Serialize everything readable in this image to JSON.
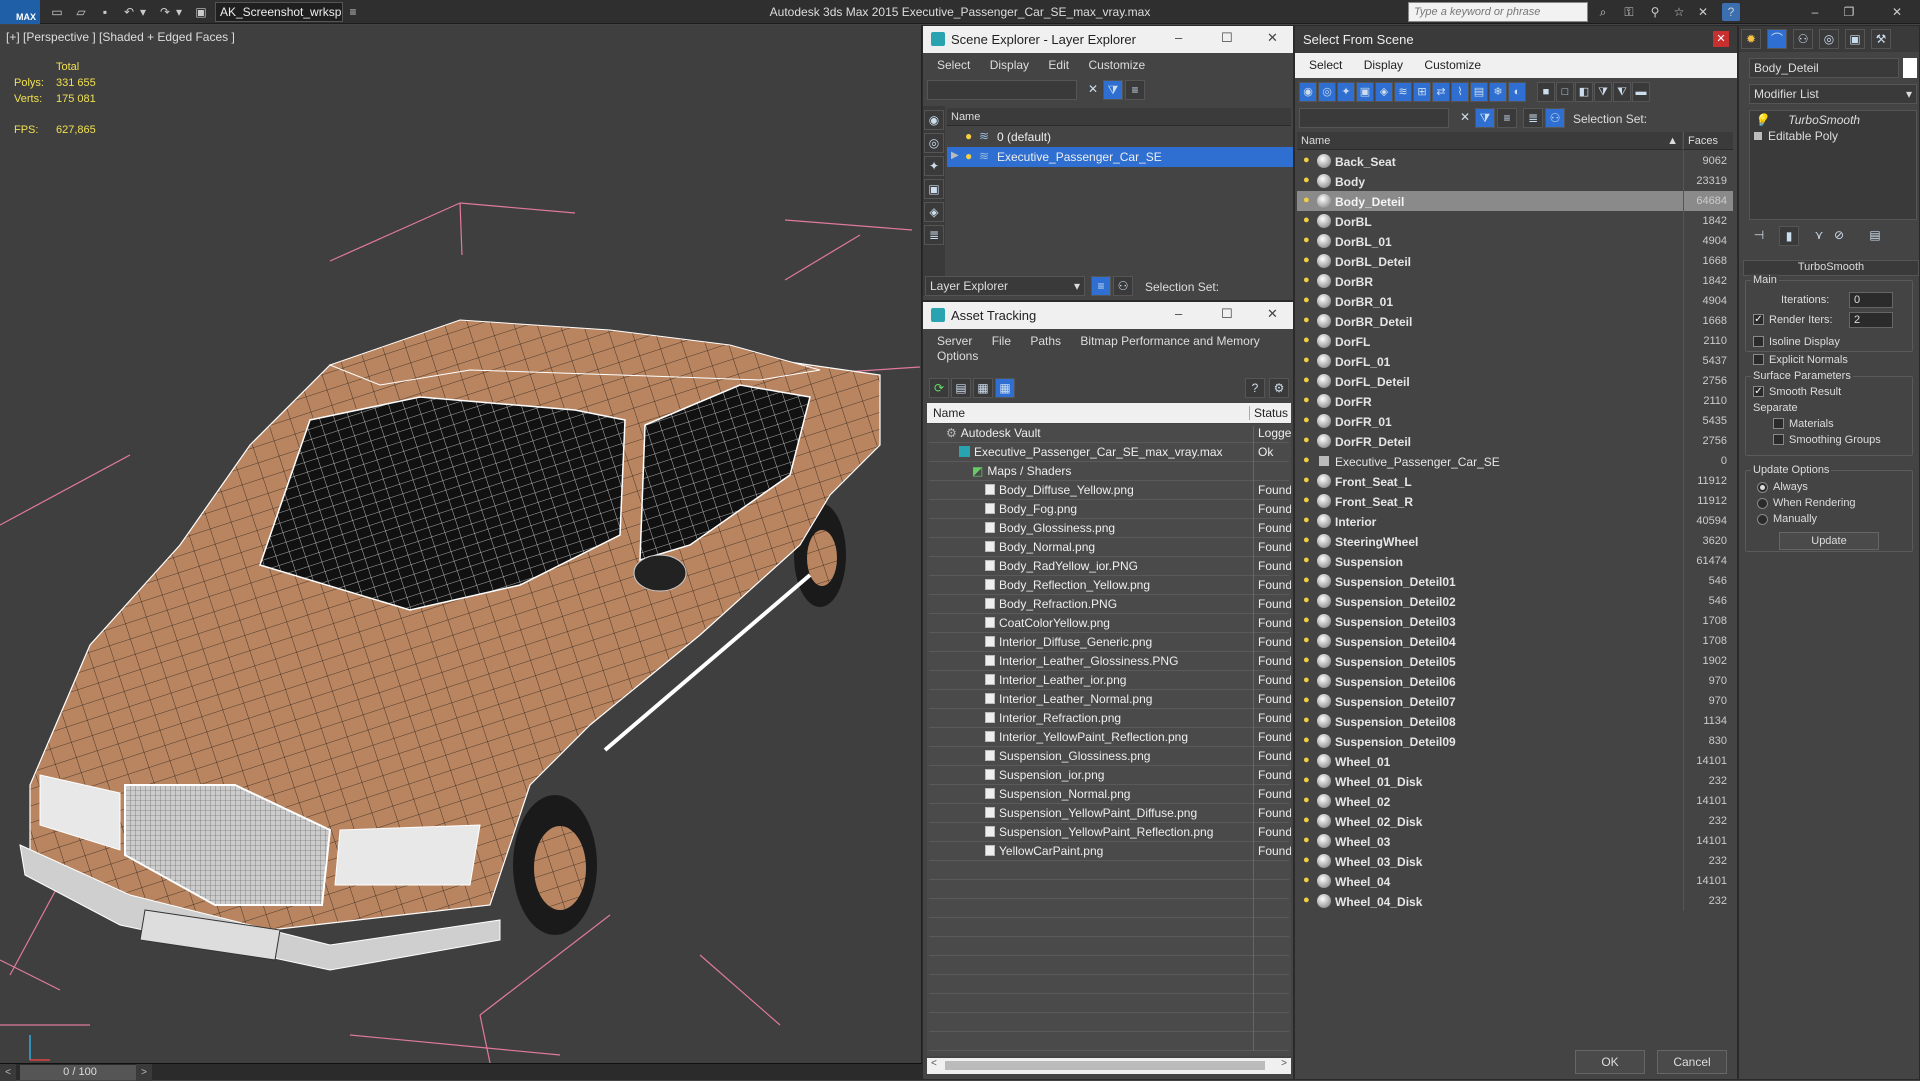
{
  "app": {
    "logo": "MAX",
    "title": "Autodesk 3ds Max  2015     Executive_Passenger_Car_SE_max_vray.max",
    "workspace": "AK_Screenshot_wrksp",
    "search_placeholder": "Type a keyword or phrase"
  },
  "viewport": {
    "label": "[+] [Perspective ] [Shaded + Edged Faces ]",
    "stats": {
      "total_label": "Total",
      "polys_label": "Polys:",
      "polys": "331 655",
      "verts_label": "Verts:",
      "verts": "175 081",
      "fps_label": "FPS:",
      "fps": "627,865"
    },
    "timeline": "0 / 100"
  },
  "scene_explorer": {
    "title": "Scene Explorer - Layer Explorer",
    "menu": [
      "Select",
      "Display",
      "Edit",
      "Customize"
    ],
    "col_name": "Name",
    "layers": [
      {
        "name": "0 (default)",
        "selected": false
      },
      {
        "name": "Executive_Passenger_Car_SE",
        "selected": true
      }
    ],
    "footer_dropdown": "Layer Explorer",
    "selection_set_label": "Selection Set:"
  },
  "asset_tracking": {
    "title": "Asset Tracking",
    "menu": [
      "Server",
      "File",
      "Paths",
      "Bitmap Performance and Memory"
    ],
    "menu2": "Options",
    "col_name": "Name",
    "col_status": "Status",
    "rows": [
      {
        "name": "Autodesk Vault",
        "status": "Logged",
        "indent": 1
      },
      {
        "name": "Executive_Passenger_Car_SE_max_vray.max",
        "status": "Ok",
        "indent": 2
      },
      {
        "name": "Maps / Shaders",
        "status": "",
        "indent": 3
      },
      {
        "name": "Body_Diffuse_Yellow.png",
        "status": "Found",
        "indent": 4
      },
      {
        "name": "Body_Fog.png",
        "status": "Found",
        "indent": 4
      },
      {
        "name": "Body_Glossiness.png",
        "status": "Found",
        "indent": 4
      },
      {
        "name": "Body_Normal.png",
        "status": "Found",
        "indent": 4
      },
      {
        "name": "Body_RadYellow_ior.PNG",
        "status": "Found",
        "indent": 4
      },
      {
        "name": "Body_Reflection_Yellow.png",
        "status": "Found",
        "indent": 4
      },
      {
        "name": "Body_Refraction.PNG",
        "status": "Found",
        "indent": 4
      },
      {
        "name": "CoatColorYellow.png",
        "status": "Found",
        "indent": 4
      },
      {
        "name": "Interior_Diffuse_Generic.png",
        "status": "Found",
        "indent": 4
      },
      {
        "name": "Interior_Leather_Glossiness.PNG",
        "status": "Found",
        "indent": 4
      },
      {
        "name": "Interior_Leather_ior.png",
        "status": "Found",
        "indent": 4
      },
      {
        "name": "Interior_Leather_Normal.png",
        "status": "Found",
        "indent": 4
      },
      {
        "name": "Interior_Refraction.png",
        "status": "Found",
        "indent": 4
      },
      {
        "name": "Interior_YellowPaint_Reflection.png",
        "status": "Found",
        "indent": 4
      },
      {
        "name": "Suspension_Glossiness.png",
        "status": "Found",
        "indent": 4
      },
      {
        "name": "Suspension_ior.png",
        "status": "Found",
        "indent": 4
      },
      {
        "name": "Suspension_Normal.png",
        "status": "Found",
        "indent": 4
      },
      {
        "name": "Suspension_YellowPaint_Diffuse.png",
        "status": "Found",
        "indent": 4
      },
      {
        "name": "Suspension_YellowPaint_Reflection.png",
        "status": "Found",
        "indent": 4
      },
      {
        "name": "YellowCarPaint.png",
        "status": "Found",
        "indent": 4
      }
    ]
  },
  "select_from_scene": {
    "title": "Select From Scene",
    "menu": [
      "Select",
      "Display",
      "Customize"
    ],
    "selection_set_label": "Selection Set:",
    "col_name": "Name",
    "col_faces": "Faces",
    "ok": "OK",
    "cancel": "Cancel",
    "objects": [
      {
        "name": "Back_Seat",
        "faces": "9062"
      },
      {
        "name": "Body",
        "faces": "23319"
      },
      {
        "name": "Body_Deteil",
        "faces": "64684",
        "selected": true
      },
      {
        "name": "DorBL",
        "faces": "1842"
      },
      {
        "name": "DorBL_01",
        "faces": "4904"
      },
      {
        "name": "DorBL_Deteil",
        "faces": "1668"
      },
      {
        "name": "DorBR",
        "faces": "1842"
      },
      {
        "name": "DorBR_01",
        "faces": "4904"
      },
      {
        "name": "DorBR_Deteil",
        "faces": "1668"
      },
      {
        "name": "DorFL",
        "faces": "2110"
      },
      {
        "name": "DorFL_01",
        "faces": "5437"
      },
      {
        "name": "DorFL_Deteil",
        "faces": "2756"
      },
      {
        "name": "DorFR",
        "faces": "2110"
      },
      {
        "name": "DorFR_01",
        "faces": "5435"
      },
      {
        "name": "DorFR_Deteil",
        "faces": "2756"
      },
      {
        "name": "Executive_Passenger_Car_SE",
        "faces": "0",
        "group": true
      },
      {
        "name": "Front_Seat_L",
        "faces": "11912"
      },
      {
        "name": "Front_Seat_R",
        "faces": "11912"
      },
      {
        "name": "Interior",
        "faces": "40594"
      },
      {
        "name": "SteeringWheel",
        "faces": "3620"
      },
      {
        "name": "Suspension",
        "faces": "61474"
      },
      {
        "name": "Suspension_Deteil01",
        "faces": "546"
      },
      {
        "name": "Suspension_Deteil02",
        "faces": "546"
      },
      {
        "name": "Suspension_Deteil03",
        "faces": "1708"
      },
      {
        "name": "Suspension_Deteil04",
        "faces": "1708"
      },
      {
        "name": "Suspension_Deteil05",
        "faces": "1902"
      },
      {
        "name": "Suspension_Deteil06",
        "faces": "970"
      },
      {
        "name": "Suspension_Deteil07",
        "faces": "970"
      },
      {
        "name": "Suspension_Deteil08",
        "faces": "1134"
      },
      {
        "name": "Suspension_Deteil09",
        "faces": "830"
      },
      {
        "name": "Wheel_01",
        "faces": "14101"
      },
      {
        "name": "Wheel_01_Disk",
        "faces": "232"
      },
      {
        "name": "Wheel_02",
        "faces": "14101"
      },
      {
        "name": "Wheel_02_Disk",
        "faces": "232"
      },
      {
        "name": "Wheel_03",
        "faces": "14101"
      },
      {
        "name": "Wheel_03_Disk",
        "faces": "232"
      },
      {
        "name": "Wheel_04",
        "faces": "14101"
      },
      {
        "name": "Wheel_04_Disk",
        "faces": "232"
      }
    ]
  },
  "modify_panel": {
    "object_name": "Body_Deteil",
    "modifier_list": "Modifier List",
    "stack": [
      "TurboSmooth",
      "Editable Poly"
    ],
    "rollout_title": "TurboSmooth",
    "main": "Main",
    "iterations_label": "Iterations:",
    "iterations": "0",
    "render_iters_label": "Render Iters:",
    "render_iters": "2",
    "isoline": "Isoline Display",
    "explicit": "Explicit Normals",
    "surface_params": "Surface Parameters",
    "smooth_result": "Smooth Result",
    "separate": "Separate",
    "materials": "Materials",
    "smoothing_groups": "Smoothing Groups",
    "update_options": "Update Options",
    "always": "Always",
    "when_rendering": "When Rendering",
    "manually": "Manually",
    "update": "Update"
  },
  "colors": {
    "accent": "#2e6fd1",
    "car_body": "#b98560",
    "viewport_bg": "#3f3f3f",
    "stats": "#f0e050"
  }
}
